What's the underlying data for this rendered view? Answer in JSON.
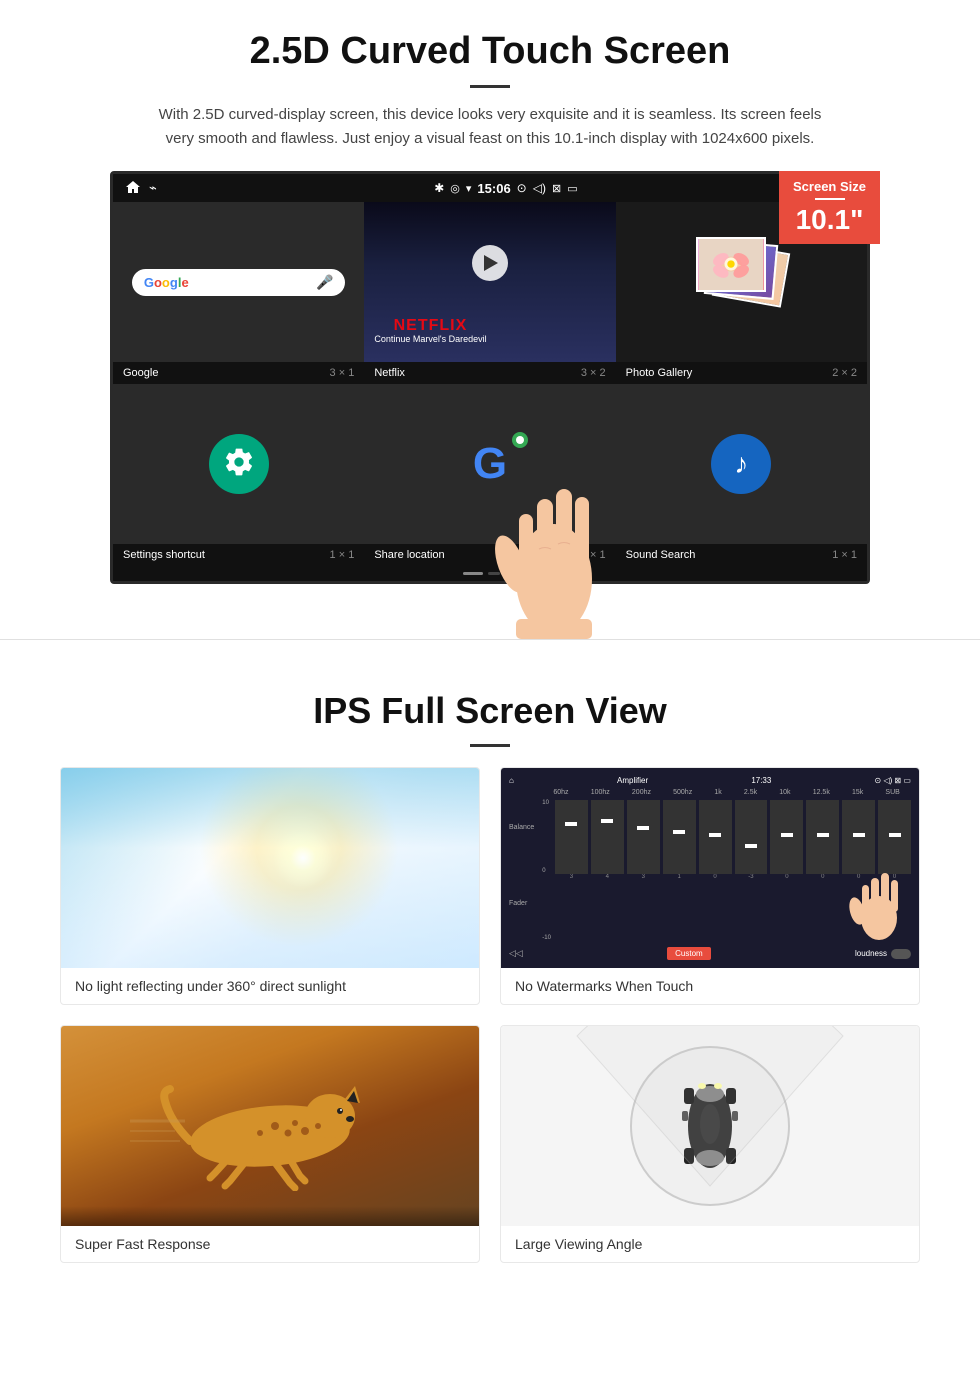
{
  "section1": {
    "title": "2.5D Curved Touch Screen",
    "description": "With 2.5D curved-display screen, this device looks very exquisite and it is seamless. Its screen feels very smooth and flawless. Just enjoy a visual feast on this 10.1-inch display with 1024x600 pixels.",
    "screen_size_badge": {
      "label": "Screen Size",
      "size": "10.1\""
    },
    "status_bar": {
      "time": "15:06"
    },
    "apps": [
      {
        "name": "Google",
        "size": "3 × 1"
      },
      {
        "name": "Netflix",
        "size": "3 × 2",
        "sub": "Continue Marvel's Daredevil"
      },
      {
        "name": "Photo Gallery",
        "size": "2 × 2"
      },
      {
        "name": "Settings shortcut",
        "size": "1 × 1"
      },
      {
        "name": "Share location",
        "size": "1 × 1"
      },
      {
        "name": "Sound Search",
        "size": "1 × 1"
      }
    ]
  },
  "section2": {
    "title": "IPS Full Screen View",
    "features": [
      {
        "id": "sunlight",
        "caption": "No light reflecting under 360° direct sunlight"
      },
      {
        "id": "amplifier",
        "caption": "No Watermarks When Touch"
      },
      {
        "id": "cheetah",
        "caption": "Super Fast Response"
      },
      {
        "id": "car",
        "caption": "Large Viewing Angle"
      }
    ],
    "amplifier": {
      "title": "Amplifier",
      "eq_labels": [
        "60hz",
        "100hz",
        "200hz",
        "500hz",
        "1k",
        "2.5k",
        "10k",
        "12.5k",
        "15k",
        "SUB"
      ],
      "bottom_label_left": "Custom",
      "bottom_label_right": "loudness",
      "side_labels": [
        "Balance",
        "Fader"
      ]
    }
  }
}
